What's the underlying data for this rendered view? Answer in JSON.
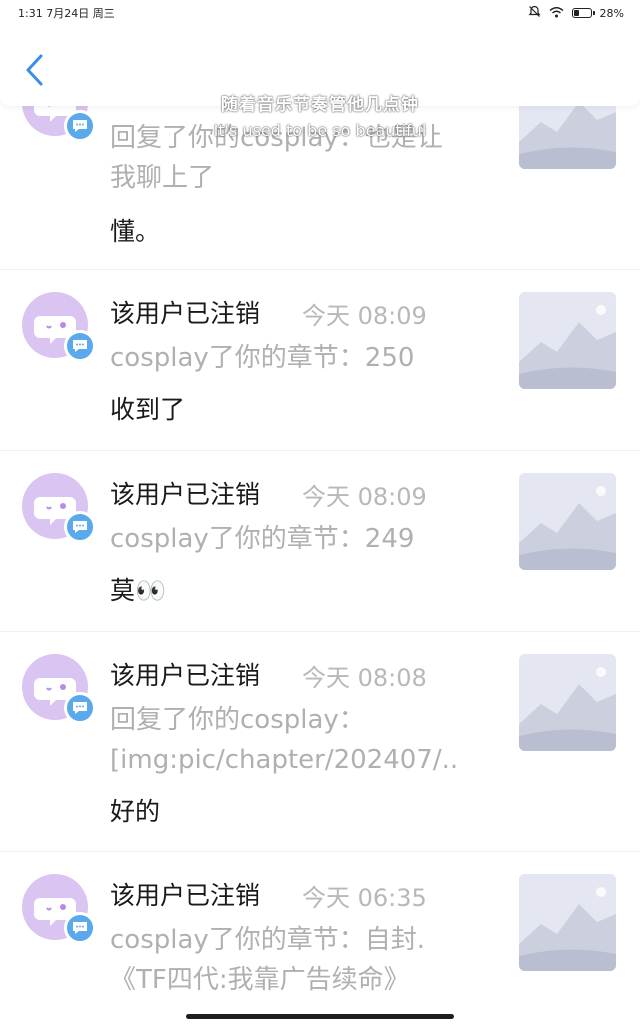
{
  "status_bar": {
    "time_date": "1:31 7月24日 周三",
    "battery_percent": "28%",
    "battery_level": 0.28,
    "icons": [
      "mute-bell-icon",
      "wifi-icon",
      "battery-icon"
    ]
  },
  "header": {
    "back_icon": "chevron-left-icon",
    "accent_color": "#3a8ee6"
  },
  "lyrics": {
    "line_cn": "随着音乐节奏管他几点钟",
    "line_en": "It's used to be so beautiful"
  },
  "messages": [
    {
      "name": "",
      "time": "",
      "quote_lines": [
        "回复了你的cosplay：也是让",
        "我聊上了"
      ],
      "reply": "懂。"
    },
    {
      "name": "该用户已注销",
      "time": "今天 08:09",
      "quote_lines": [
        "cosplay了你的章节：250"
      ],
      "reply": "收到了"
    },
    {
      "name": "该用户已注销",
      "time": "今天 08:09",
      "quote_lines": [
        "cosplay了你的章节：249"
      ],
      "reply": "莫👀"
    },
    {
      "name": "该用户已注销",
      "time": "今天 08:08",
      "quote_lines": [
        "回复了你的cosplay：",
        "[img:pic/chapter/202407/.."
      ],
      "reply": "好的"
    },
    {
      "name": "该用户已注销",
      "time": "今天 06:35",
      "quote_lines": [
        "cosplay了你的章节：自封.",
        "《TF四代:我靠广告续命》"
      ],
      "reply": ""
    }
  ]
}
